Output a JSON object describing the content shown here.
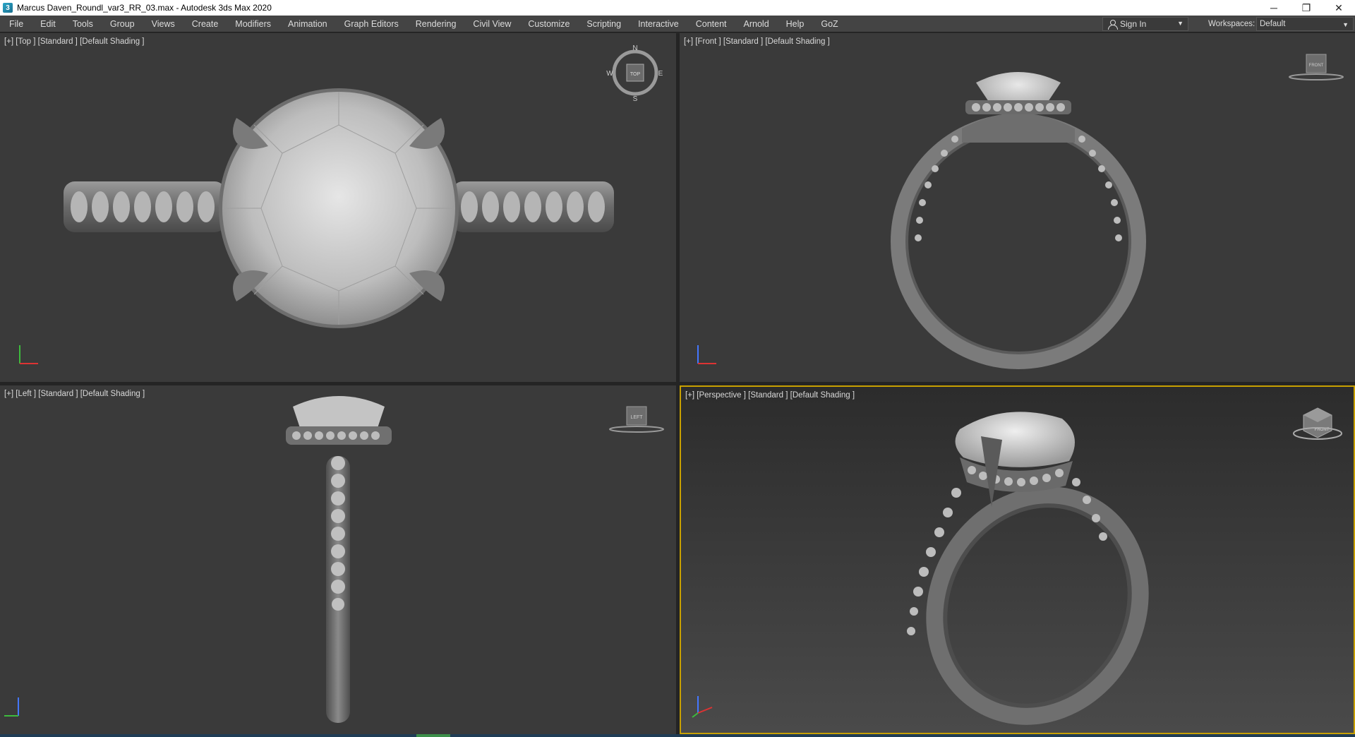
{
  "window": {
    "title": "Marcus Daven_Roundl_var3_RR_03.max - Autodesk 3ds Max 2020",
    "minimize_glyph": "─",
    "maximize_glyph": "❐",
    "close_glyph": "✕"
  },
  "menu": [
    "File",
    "Edit",
    "Tools",
    "Group",
    "Views",
    "Create",
    "Modifiers",
    "Animation",
    "Graph Editors",
    "Rendering",
    "Civil View",
    "Customize",
    "Scripting",
    "Interactive",
    "Content",
    "Arnold",
    "Help",
    "GoZ"
  ],
  "signin": {
    "label": "Sign In",
    "icon": "person-icon"
  },
  "workspaces": {
    "label": "Workspaces:",
    "value": "Default"
  },
  "viewports": {
    "top": {
      "label": "[+] [Top ] [Standard ] [Default Shading ]",
      "cube_label": "TOP",
      "compass": [
        "N",
        "E",
        "S",
        "W"
      ]
    },
    "front": {
      "label": "[+] [Front ] [Standard ] [Default Shading ]",
      "cube_label": "FRONT"
    },
    "left": {
      "label": "[+] [Left ] [Standard ] [Default Shading ]",
      "cube_label": "LEFT"
    },
    "persp": {
      "label": "[+] [Perspective ] [Standard ] [Default Shading ]",
      "cube_label": "FRONT"
    }
  },
  "colors": {
    "viewport_bg": "#3a3a3a",
    "active_border": "#c8a000",
    "menu_bg": "#444444",
    "metal": "#8a8a8a",
    "gem": "#c8c8c8"
  }
}
